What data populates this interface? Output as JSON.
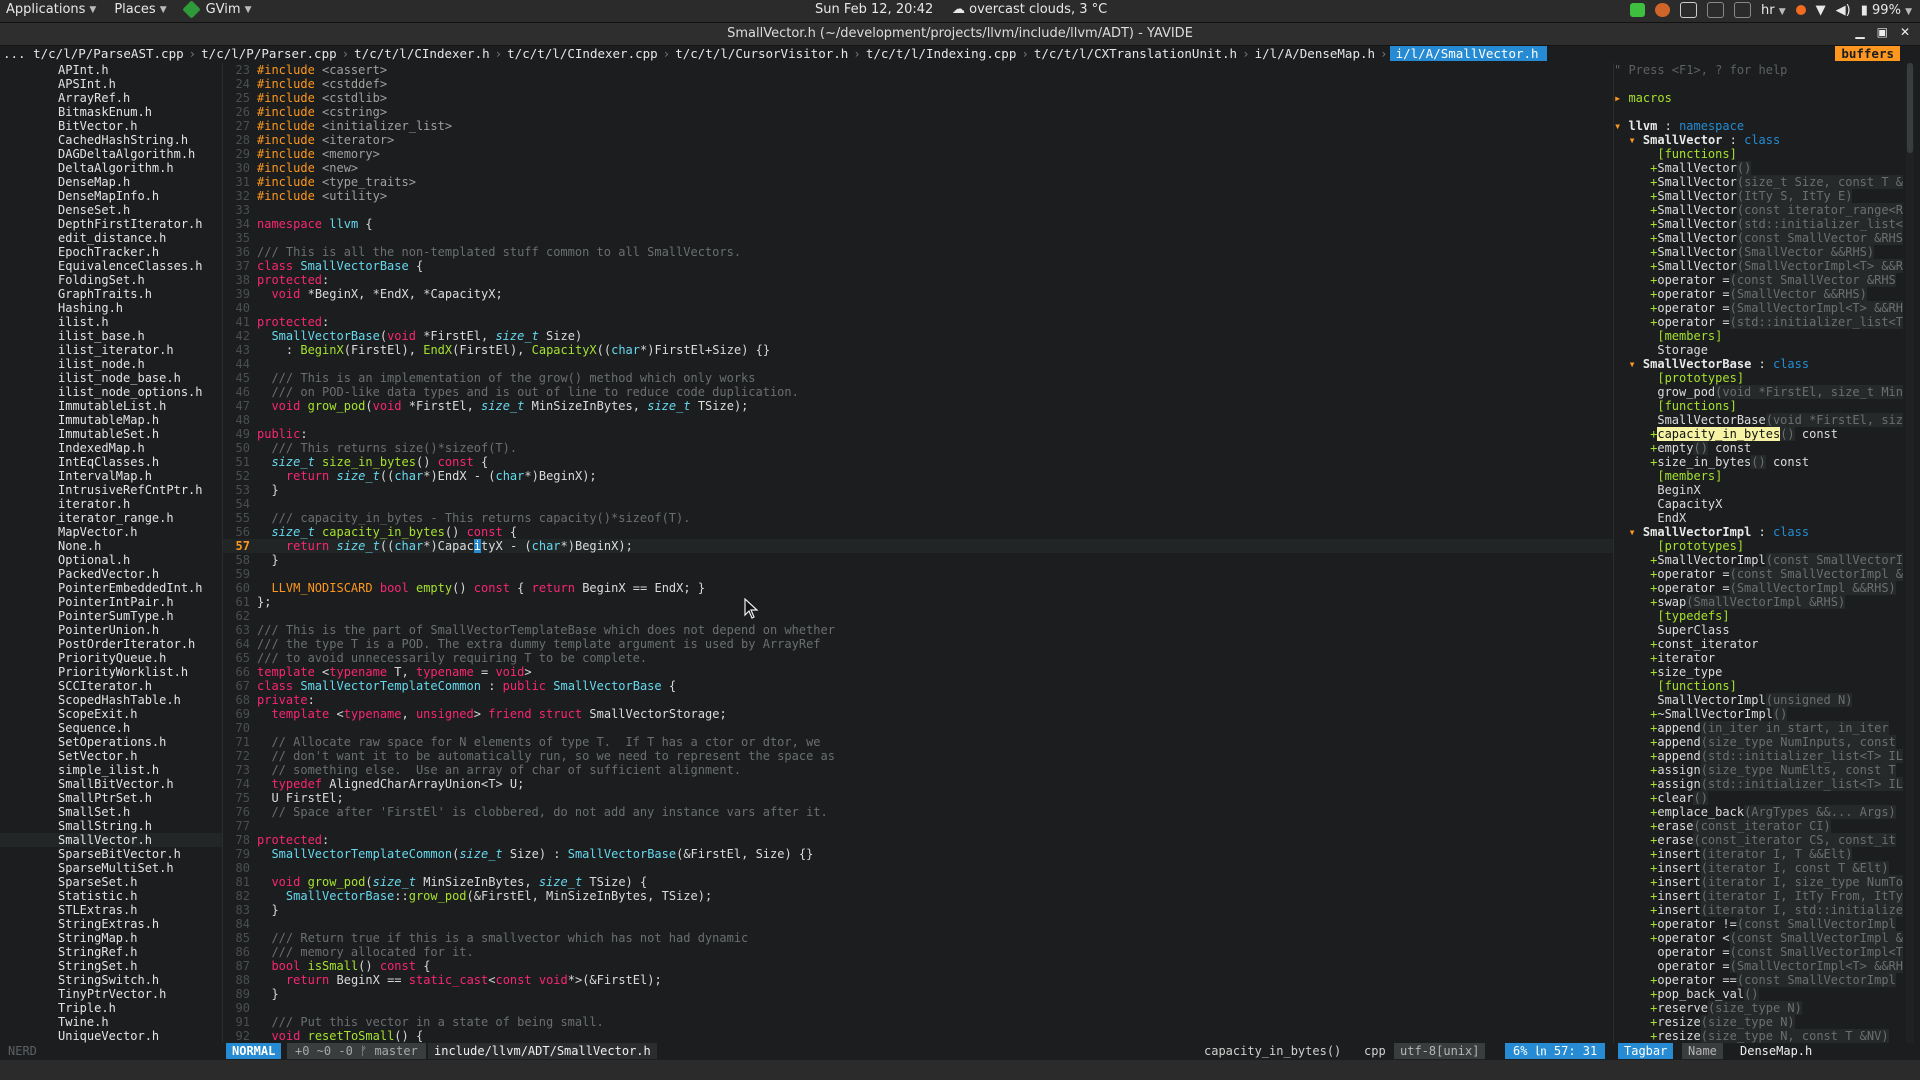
{
  "panel": {
    "applications": "Applications",
    "places": "Places",
    "gvim": "GVim",
    "clock": "Sun Feb 12, 20:42",
    "weather": "overcast clouds, 3 °C",
    "keyboard": "hr",
    "battery": "99%"
  },
  "window": {
    "title": "SmallVector.h (~/development/projects/llvm/include/llvm/ADT) - YAVIDE"
  },
  "tabline": {
    "tabs": [
      "... t/c/l/P/ParseAST.cpp",
      "t/c/l/P/Parser.cpp",
      "t/c/t/l/CIndexer.h",
      "t/c/t/l/CIndexer.cpp",
      "t/c/t/l/CursorVisitor.h",
      "t/c/t/l/Indexing.cpp",
      "t/c/t/l/CXTranslationUnit.h",
      "i/l/A/DenseMap.h"
    ],
    "active": "i/l/A/SmallVector.h",
    "buffers": "buffers"
  },
  "tree": {
    "selected_index": 55,
    "files": [
      "APInt.h",
      "APSInt.h",
      "ArrayRef.h",
      "BitmaskEnum.h",
      "BitVector.h",
      "CachedHashString.h",
      "DAGDeltaAlgorithm.h",
      "DeltaAlgorithm.h",
      "DenseMap.h",
      "DenseMapInfo.h",
      "DenseSet.h",
      "DepthFirstIterator.h",
      "edit_distance.h",
      "EpochTracker.h",
      "EquivalenceClasses.h",
      "FoldingSet.h",
      "GraphTraits.h",
      "Hashing.h",
      "ilist.h",
      "ilist_base.h",
      "ilist_iterator.h",
      "ilist_node.h",
      "ilist_node_base.h",
      "ilist_node_options.h",
      "ImmutableList.h",
      "ImmutableMap.h",
      "ImmutableSet.h",
      "IndexedMap.h",
      "IntEqClasses.h",
      "IntervalMap.h",
      "IntrusiveRefCntPtr.h",
      "iterator.h",
      "iterator_range.h",
      "MapVector.h",
      "None.h",
      "Optional.h",
      "PackedVector.h",
      "PointerEmbeddedInt.h",
      "PointerIntPair.h",
      "PointerSumType.h",
      "PointerUnion.h",
      "PostOrderIterator.h",
      "PriorityQueue.h",
      "PriorityWorklist.h",
      "SCCIterator.h",
      "ScopedHashTable.h",
      "ScopeExit.h",
      "Sequence.h",
      "SetOperations.h",
      "SetVector.h",
      "simple_ilist.h",
      "SmallBitVector.h",
      "SmallPtrSet.h",
      "SmallSet.h",
      "SmallString.h",
      "SmallVector.h",
      "SparseBitVector.h",
      "SparseMultiSet.h",
      "SparseSet.h",
      "Statistic.h",
      "STLExtras.h",
      "StringExtras.h",
      "StringMap.h",
      "StringRef.h",
      "StringSet.h",
      "StringSwitch.h",
      "TinyPtrVector.h",
      "Triple.h",
      "Twine.h",
      "UniqueVector.h"
    ]
  },
  "code": {
    "current_line": 57,
    "lines": [
      {
        "n": "23",
        "t": "#include <cassert>"
      },
      {
        "n": "24",
        "t": "#include <cstddef>"
      },
      {
        "n": "25",
        "t": "#include <cstdlib>"
      },
      {
        "n": "26",
        "t": "#include <cstring>"
      },
      {
        "n": "27",
        "t": "#include <initializer_list>"
      },
      {
        "n": "28",
        "t": "#include <iterator>"
      },
      {
        "n": "29",
        "t": "#include <memory>"
      },
      {
        "n": "30",
        "t": "#include <new>"
      },
      {
        "n": "31",
        "t": "#include <type_traits>"
      },
      {
        "n": "32",
        "t": "#include <utility>"
      },
      {
        "n": "33",
        "t": ""
      },
      {
        "n": "34",
        "t": "namespace llvm {"
      },
      {
        "n": "35",
        "t": ""
      },
      {
        "n": "36",
        "t": "/// This is all the non-templated stuff common to all SmallVectors."
      },
      {
        "n": "37",
        "t": "class SmallVectorBase {"
      },
      {
        "n": "38",
        "t": "protected:"
      },
      {
        "n": "39",
        "t": "  void *BeginX, *EndX, *CapacityX;"
      },
      {
        "n": "40",
        "t": ""
      },
      {
        "n": "41",
        "t": "protected:"
      },
      {
        "n": "42",
        "t": "  SmallVectorBase(void *FirstEl, size_t Size)"
      },
      {
        "n": "43",
        "t": "    : BeginX(FirstEl), EndX(FirstEl), CapacityX((char*)FirstEl+Size) {}"
      },
      {
        "n": "44",
        "t": ""
      },
      {
        "n": "45",
        "t": "  /// This is an implementation of the grow() method which only works"
      },
      {
        "n": "46",
        "t": "  /// on POD-like data types and is out of line to reduce code duplication."
      },
      {
        "n": "47",
        "t": "  void grow_pod(void *FirstEl, size_t MinSizeInBytes, size_t TSize);"
      },
      {
        "n": "48",
        "t": ""
      },
      {
        "n": "49",
        "t": "public:"
      },
      {
        "n": "50",
        "t": "  /// This returns size()*sizeof(T)."
      },
      {
        "n": "51",
        "t": "  size_t size_in_bytes() const {"
      },
      {
        "n": "52",
        "t": "    return size_t((char*)EndX - (char*)BeginX);"
      },
      {
        "n": "53",
        "t": "  }"
      },
      {
        "n": "54",
        "t": ""
      },
      {
        "n": "55",
        "t": "  /// capacity_in_bytes - This returns capacity()*sizeof(T)."
      },
      {
        "n": "56",
        "t": "  size_t capacity_in_bytes() const {"
      },
      {
        "n": "57",
        "t": "    return size_t((char*)CapacityX - (char*)BeginX);"
      },
      {
        "n": "58",
        "t": "  }"
      },
      {
        "n": "59",
        "t": ""
      },
      {
        "n": "60",
        "t": "  LLVM_NODISCARD bool empty() const { return BeginX == EndX; }"
      },
      {
        "n": "61",
        "t": "};"
      },
      {
        "n": "62",
        "t": ""
      },
      {
        "n": "63",
        "t": "/// This is the part of SmallVectorTemplateBase which does not depend on whether"
      },
      {
        "n": "64",
        "t": "/// the type T is a POD. The extra dummy template argument is used by ArrayRef"
      },
      {
        "n": "65",
        "t": "/// to avoid unnecessarily requiring T to be complete."
      },
      {
        "n": "66",
        "t": "template <typename T, typename = void>"
      },
      {
        "n": "67",
        "t": "class SmallVectorTemplateCommon : public SmallVectorBase {"
      },
      {
        "n": "68",
        "t": "private:"
      },
      {
        "n": "69",
        "t": "  template <typename, unsigned> friend struct SmallVectorStorage;"
      },
      {
        "n": "70",
        "t": ""
      },
      {
        "n": "71",
        "t": "  // Allocate raw space for N elements of type T.  If T has a ctor or dtor, we"
      },
      {
        "n": "72",
        "t": "  // don't want it to be automatically run, so we need to represent the space as"
      },
      {
        "n": "73",
        "t": "  // something else.  Use an array of char of sufficient alignment."
      },
      {
        "n": "74",
        "t": "  typedef AlignedCharArrayUnion<T> U;"
      },
      {
        "n": "75",
        "t": "  U FirstEl;"
      },
      {
        "n": "76",
        "t": "  // Space after 'FirstEl' is clobbered, do not add any instance vars after it."
      },
      {
        "n": "77",
        "t": ""
      },
      {
        "n": "78",
        "t": "protected:"
      },
      {
        "n": "79",
        "t": "  SmallVectorTemplateCommon(size_t Size) : SmallVectorBase(&FirstEl, Size) {}"
      },
      {
        "n": "80",
        "t": ""
      },
      {
        "n": "81",
        "t": "  void grow_pod(size_t MinSizeInBytes, size_t TSize) {"
      },
      {
        "n": "82",
        "t": "    SmallVectorBase::grow_pod(&FirstEl, MinSizeInBytes, TSize);"
      },
      {
        "n": "83",
        "t": "  }"
      },
      {
        "n": "84",
        "t": ""
      },
      {
        "n": "85",
        "t": "  /// Return true if this is a smallvector which has not had dynamic"
      },
      {
        "n": "86",
        "t": "  /// memory allocated for it."
      },
      {
        "n": "87",
        "t": "  bool isSmall() const {"
      },
      {
        "n": "88",
        "t": "    return BeginX == static_cast<const void*>(&FirstEl);"
      },
      {
        "n": "89",
        "t": "  }"
      },
      {
        "n": "90",
        "t": ""
      },
      {
        "n": "91",
        "t": "  /// Put this vector in a state of being small."
      },
      {
        "n": "92",
        "t": "  void resetToSmall() {"
      }
    ]
  },
  "tagbar": {
    "rows": [
      {
        "k": "help",
        "t": "\" Press <F1>, ? for help"
      },
      {
        "k": "blank",
        "t": ""
      },
      {
        "k": "fold",
        "t": "▸ macros"
      },
      {
        "k": "blank",
        "t": ""
      },
      {
        "k": "ns",
        "t": "▾ llvm : namespace"
      },
      {
        "k": "cls",
        "t": "  ▾ SmallVector : class"
      },
      {
        "k": "sect",
        "t": "      [functions]"
      },
      {
        "k": "m",
        "p": "+",
        "n": "SmallVector",
        "s": "()"
      },
      {
        "k": "m",
        "p": "+",
        "n": "SmallVector",
        "s": "(size_t Size, const T &"
      },
      {
        "k": "m",
        "p": "+",
        "n": "SmallVector",
        "s": "(ItTy S, ItTy E)"
      },
      {
        "k": "m",
        "p": "+",
        "n": "SmallVector",
        "s": "(const iterator_range<R"
      },
      {
        "k": "m",
        "p": "+",
        "n": "SmallVector",
        "s": "(std::initializer_list<"
      },
      {
        "k": "m",
        "p": "+",
        "n": "SmallVector",
        "s": "(const SmallVector &RHS"
      },
      {
        "k": "m",
        "p": "+",
        "n": "SmallVector",
        "s": "(SmallVector &&RHS)"
      },
      {
        "k": "m",
        "p": "+",
        "n": "SmallVector",
        "s": "(SmallVectorImpl<T> &&R"
      },
      {
        "k": "m",
        "p": "+",
        "n": "operator =",
        "s": "(const SmallVector &RHS"
      },
      {
        "k": "m",
        "p": "+",
        "n": "operator =",
        "s": "(SmallVector &&RHS)"
      },
      {
        "k": "m",
        "p": "+",
        "n": "operator =",
        "s": "(SmallVectorImpl<T> &&RH"
      },
      {
        "k": "m",
        "p": "+",
        "n": "operator =",
        "s": "(std::initializer_list<T"
      },
      {
        "k": "sect",
        "t": "      [members]"
      },
      {
        "k": "m",
        "p": " ",
        "n": "Storage",
        "s": ""
      },
      {
        "k": "cls",
        "t": "  ▾ SmallVectorBase : class"
      },
      {
        "k": "sect",
        "t": "      [prototypes]"
      },
      {
        "k": "m",
        "p": " ",
        "n": "grow_pod",
        "s": "(void *FirstEl, size_t Min"
      },
      {
        "k": "sect",
        "t": "      [functions]"
      },
      {
        "k": "m",
        "p": " ",
        "n": "SmallVectorBase",
        "s": "(void *FirstEl, siz"
      },
      {
        "k": "hl",
        "p": "+",
        "n": "capacity_in_bytes",
        "s": "()",
        "x": " const"
      },
      {
        "k": "m",
        "p": "+",
        "n": "empty",
        "s": "()",
        "x": " const"
      },
      {
        "k": "m",
        "p": "+",
        "n": "size_in_bytes",
        "s": "()",
        "x": " const"
      },
      {
        "k": "sect",
        "t": "      [members]"
      },
      {
        "k": "m",
        "p": " ",
        "n": "BeginX",
        "s": ""
      },
      {
        "k": "m",
        "p": " ",
        "n": "CapacityX",
        "s": ""
      },
      {
        "k": "m",
        "p": " ",
        "n": "EndX",
        "s": ""
      },
      {
        "k": "cls",
        "t": "  ▾ SmallVectorImpl : class"
      },
      {
        "k": "sect",
        "t": "      [prototypes]"
      },
      {
        "k": "m",
        "p": "+",
        "n": "SmallVectorImpl",
        "s": "(const SmallVectorI"
      },
      {
        "k": "m",
        "p": "+",
        "n": "operator =",
        "s": "(const SmallVectorImpl &"
      },
      {
        "k": "m",
        "p": "+",
        "n": "operator =",
        "s": "(SmallVectorImpl &&RHS)"
      },
      {
        "k": "m",
        "p": "+",
        "n": "swap",
        "s": "(SmallVectorImpl &RHS)"
      },
      {
        "k": "sect",
        "t": "      [typedefs]"
      },
      {
        "k": "m",
        "p": " ",
        "n": "SuperClass",
        "s": ""
      },
      {
        "k": "m",
        "p": "+",
        "n": "const_iterator",
        "s": ""
      },
      {
        "k": "m",
        "p": "+",
        "n": "iterator",
        "s": ""
      },
      {
        "k": "m",
        "p": "+",
        "n": "size_type",
        "s": ""
      },
      {
        "k": "sect",
        "t": "      [functions]"
      },
      {
        "k": "m",
        "p": " ",
        "n": "SmallVectorImpl",
        "s": "(unsigned N)"
      },
      {
        "k": "m",
        "p": "+",
        "n": "~SmallVectorImpl",
        "s": "()"
      },
      {
        "k": "m",
        "p": "+",
        "n": "append",
        "s": "(in_iter in_start, in_iter"
      },
      {
        "k": "m",
        "p": "+",
        "n": "append",
        "s": "(size_type NumInputs, const"
      },
      {
        "k": "m",
        "p": "+",
        "n": "append",
        "s": "(std::initializer_list<T> IL"
      },
      {
        "k": "m",
        "p": "+",
        "n": "assign",
        "s": "(size_type NumElts, const T"
      },
      {
        "k": "m",
        "p": "+",
        "n": "assign",
        "s": "(std::initializer_list<T> IL"
      },
      {
        "k": "m",
        "p": "+",
        "n": "clear",
        "s": "()"
      },
      {
        "k": "m",
        "p": "+",
        "n": "emplace_back",
        "s": "(ArgTypes &&... Args)"
      },
      {
        "k": "m",
        "p": "+",
        "n": "erase",
        "s": "(const_iterator CI)"
      },
      {
        "k": "m",
        "p": "+",
        "n": "erase",
        "s": "(const_iterator CS, const_it"
      },
      {
        "k": "m",
        "p": "+",
        "n": "insert",
        "s": "(iterator I, T &&Elt)"
      },
      {
        "k": "m",
        "p": "+",
        "n": "insert",
        "s": "(iterator I, const T &Elt)"
      },
      {
        "k": "m",
        "p": "+",
        "n": "insert",
        "s": "(iterator I, size_type NumTo"
      },
      {
        "k": "m",
        "p": "+",
        "n": "insert",
        "s": "(iterator I, ItTy From, ItTy"
      },
      {
        "k": "m",
        "p": "+",
        "n": "insert",
        "s": "(iterator I, std::initialize"
      },
      {
        "k": "m",
        "p": "+",
        "n": "operator !=",
        "s": "(const SmallVectorImpl"
      },
      {
        "k": "m",
        "p": "+",
        "n": "operator <",
        "s": "(const SmallVectorImpl &"
      },
      {
        "k": "m",
        "p": " ",
        "n": "operator =",
        "s": "(const SmallVectorImpl<T"
      },
      {
        "k": "m",
        "p": " ",
        "n": "operator =",
        "s": "(SmallVectorImpl<T> &&RH"
      },
      {
        "k": "m",
        "p": "+",
        "n": "operator ==",
        "s": "(const SmallVectorImpl"
      },
      {
        "k": "m",
        "p": "+",
        "n": "pop_back_val",
        "s": "()"
      },
      {
        "k": "m",
        "p": "+",
        "n": "reserve",
        "s": "(size_type N)"
      },
      {
        "k": "m",
        "p": "+",
        "n": "resize",
        "s": "(size_type N)"
      },
      {
        "k": "m",
        "p": "+",
        "n": "resize",
        "s": "(size_type N, const T &NV)"
      }
    ]
  },
  "status": {
    "left_name": "NERD",
    "mode": "NORMAL",
    "git": "+0 ~0 -0 ᚠ master",
    "path": "include/llvm/ADT/SmallVector.h",
    "func": "capacity_in_bytes()",
    "filetype": "cpp",
    "encoding": "utf-8[unix]",
    "position": "6% ㏑  57: 31",
    "tagbar_name": "Tagbar",
    "tagbar_sort": "Name",
    "tagbar_file": "DenseMap.h"
  }
}
